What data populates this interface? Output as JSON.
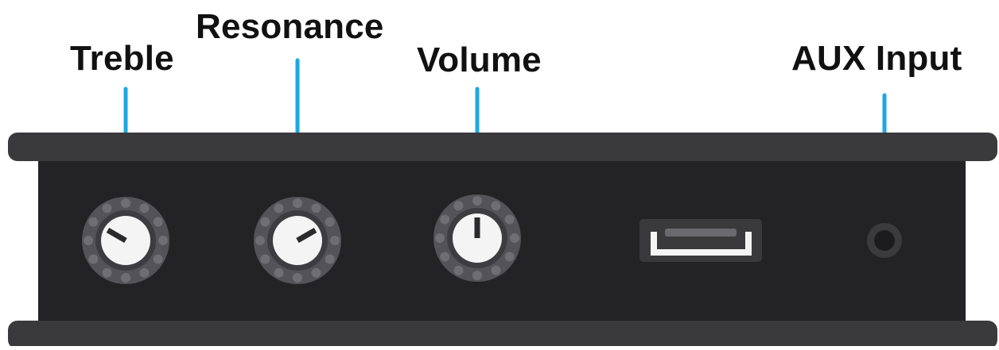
{
  "labels": {
    "treble": "Treble",
    "resonance": "Resonance",
    "volume": "Volume",
    "aux_input": "AUX Input"
  },
  "colors": {
    "leader_line": "#1ea7e1",
    "rail": "#3a3a3c",
    "rail_shade": "#2a2a2c",
    "body": "#232325",
    "body_dark": "#1b1b1d",
    "knob_ring": "#545458",
    "knob_teeth": "#6f6f73",
    "knob_face": "#f4f4f4",
    "pointer": "#2a2a2c",
    "port_frame": "#3a3a3c",
    "port_slot": "#f4f4f4",
    "jack_outer": "#3b3b3e",
    "jack_inner": "#1c1c1e",
    "label_text": "#111111"
  },
  "knobs": [
    {
      "name": "treble",
      "pointer_angle_deg": -60
    },
    {
      "name": "resonance",
      "pointer_angle_deg": 60
    },
    {
      "name": "volume",
      "pointer_angle_deg": 0
    }
  ],
  "icons": {
    "usb_port": "usb-port-icon",
    "aux_jack": "aux-jack-icon"
  }
}
